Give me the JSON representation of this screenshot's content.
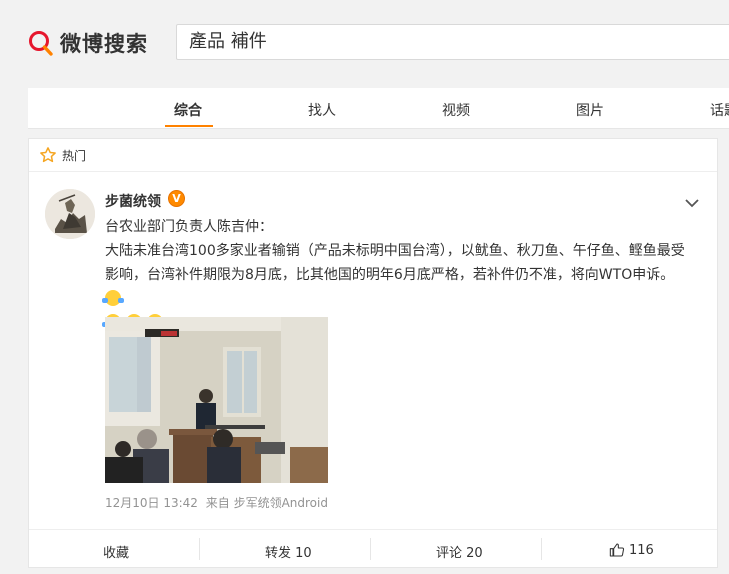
{
  "header": {
    "logo_text": "微博搜索",
    "search_value": "產品 補件"
  },
  "tabs": [
    {
      "label": "综合",
      "active": true
    },
    {
      "label": "找人",
      "active": false
    },
    {
      "label": "视频",
      "active": false
    },
    {
      "label": "图片",
      "active": false
    },
    {
      "label": "话题",
      "active": false
    }
  ],
  "hot": {
    "label": "热门"
  },
  "post": {
    "username": "步菌统领",
    "verified_badge": "V",
    "line1": "台农业部门负责人陈吉仲：",
    "body": "大陆未准台湾100多家业者输销（产品未标明中国台湾），以鱿鱼、秋刀鱼、午仔鱼、鲣鱼最受影响，台湾补件期限为8月底，比其他国的明年6月底严格，若补件仍不准，将向WTO申诉。",
    "timestamp": "12月10日 13:42",
    "source": "来自 步军统领Android"
  },
  "actions": {
    "favorite": "收藏",
    "repost": "转发 10",
    "comment": "评论 20",
    "like": "116"
  },
  "colors": {
    "accent": "#ff8200",
    "logo_red": "#e6162d",
    "meta_gray": "#939393"
  }
}
